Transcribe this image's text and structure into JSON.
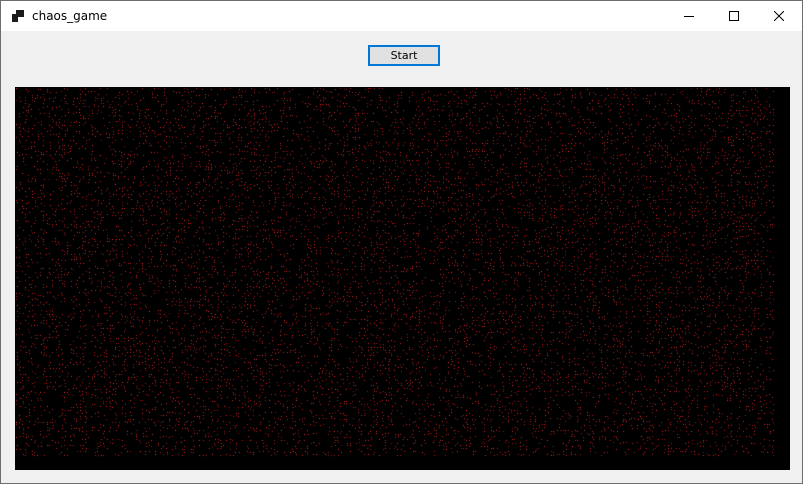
{
  "window": {
    "title": "chaos_game",
    "icon": "app-icon",
    "controls": {
      "minimize_icon": "minimize-icon",
      "maximize_icon": "maximize-icon",
      "close_icon": "close-icon"
    }
  },
  "toolbar": {
    "start_label": "Start"
  },
  "canvas": {
    "background": "#000000",
    "point_color": "#ff2a2a"
  },
  "colors": {
    "window_bg": "#f0f0f0",
    "titlebar_bg": "#ffffff",
    "button_focus": "#0078d7",
    "button_bg": "#e1e1e1"
  }
}
